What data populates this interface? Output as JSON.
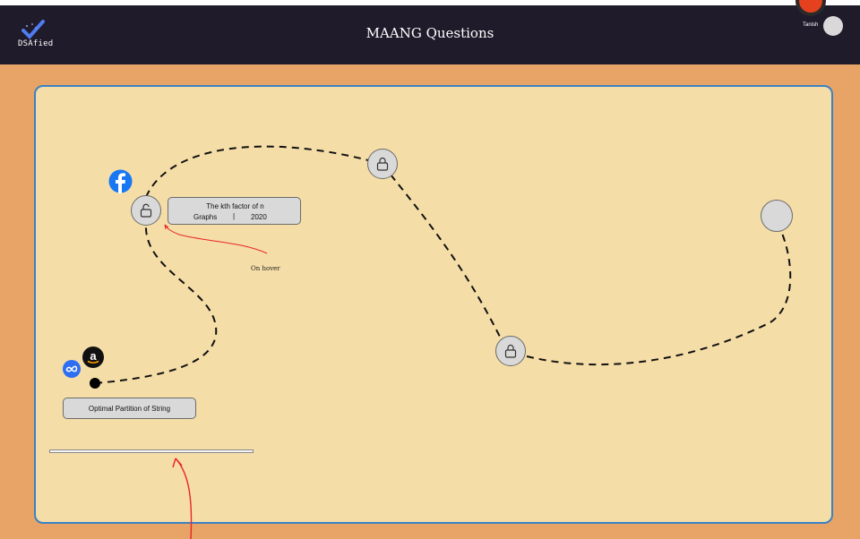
{
  "app": {
    "logo_text": "DSAfied",
    "title": "MAANG Questions",
    "user_name": "Tanish"
  },
  "board": {
    "start_node": {
      "label": "Optimal Partition of String",
      "companies": [
        "meta-icon",
        "amazon-icon"
      ]
    },
    "nodes": [
      {
        "name": "facebook-question-node",
        "state": "unlocked",
        "icon": "unlock-icon",
        "company": "facebook-icon"
      },
      {
        "name": "question-node-2",
        "state": "locked",
        "icon": "lock-icon"
      },
      {
        "name": "question-node-3",
        "state": "locked",
        "icon": "lock-icon"
      },
      {
        "name": "question-node-4",
        "state": "empty"
      }
    ],
    "tooltip": {
      "title": "The kth factor of n",
      "topic": "Graphs",
      "separator": "|",
      "year": "2020"
    },
    "annotation": "On hover",
    "progress": 0
  },
  "colors": {
    "page_bg": "#e7a466",
    "header_bg": "#1f1b2a",
    "board_bg": "#f5dda7",
    "board_border": "#3b82c4",
    "node_fill": "#d9d9d9",
    "annotation_red": "#e8252a"
  }
}
